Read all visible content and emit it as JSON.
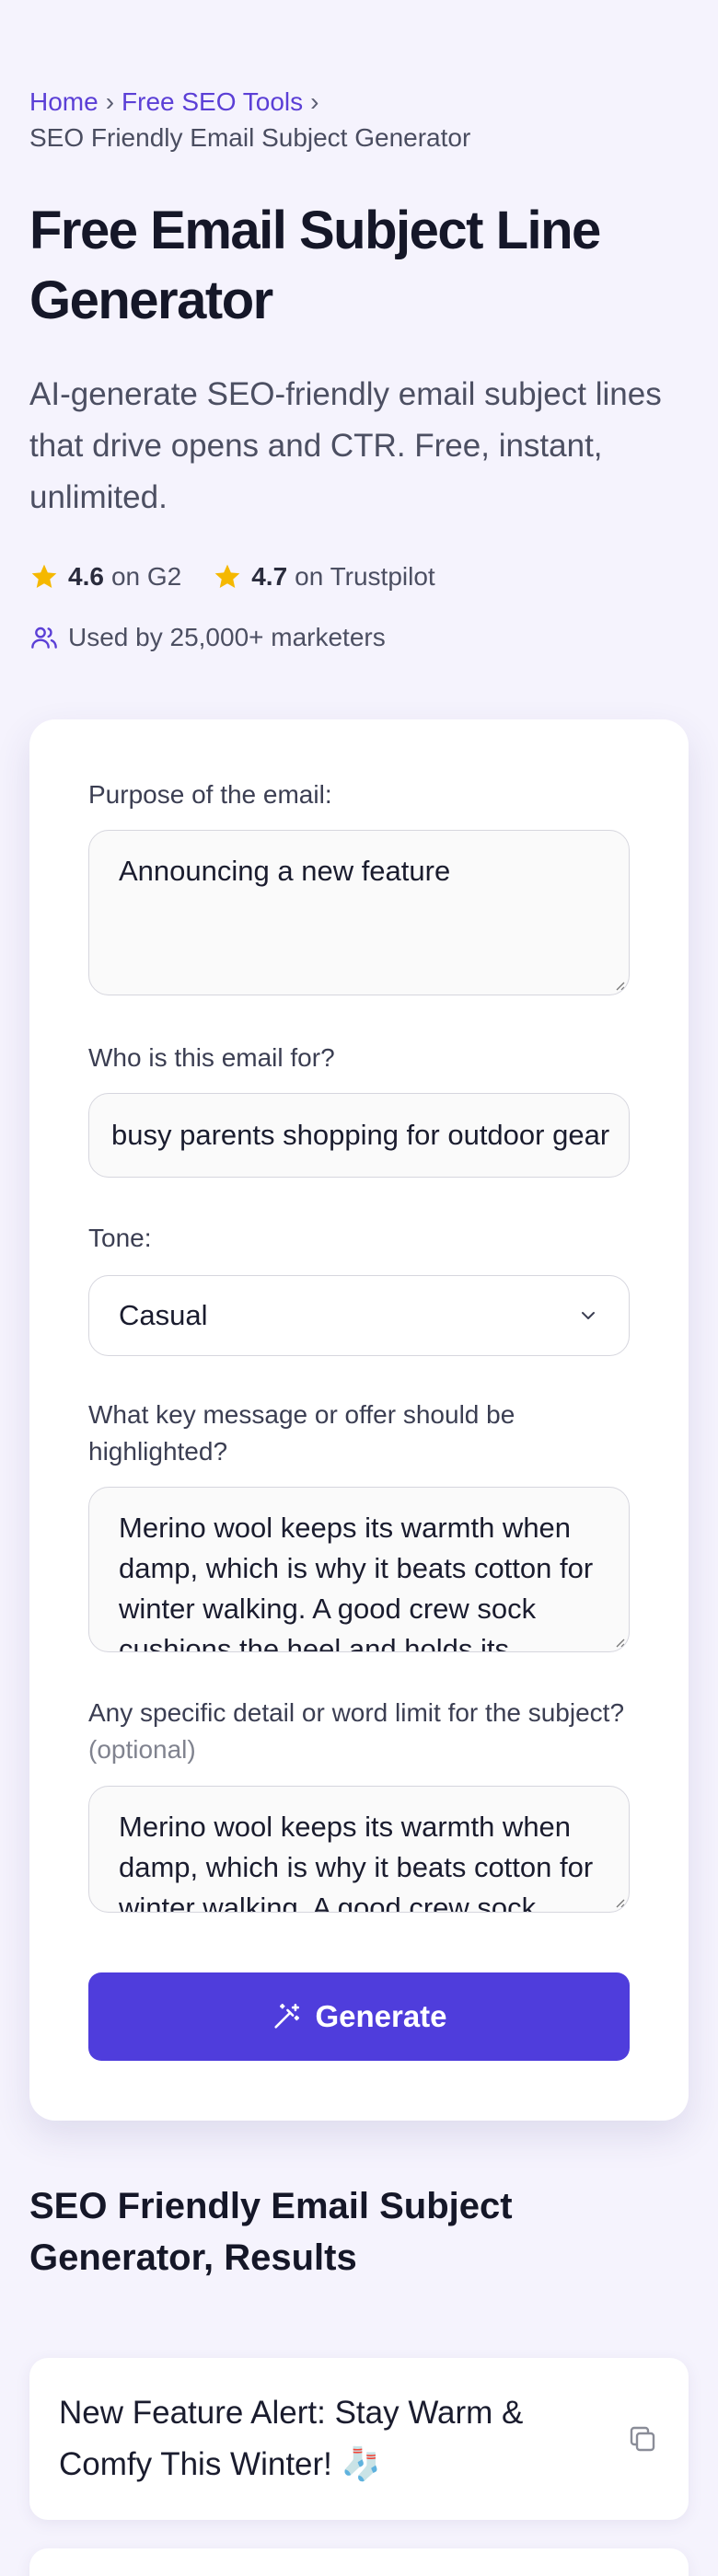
{
  "breadcrumb": {
    "home": "Home",
    "tools": "Free SEO Tools",
    "separator": "›",
    "current": "SEO Friendly Email Subject Generator"
  },
  "header": {
    "title": "Free Email Subject Line Generator",
    "subtitle": "AI-generate SEO-friendly email subject lines that drive opens and CTR. Free, instant, unlimited."
  },
  "ratings": [
    {
      "score": "4.6",
      "site": "on G2"
    },
    {
      "score": "4.7",
      "site": "on Trustpilot"
    }
  ],
  "users_text": "Used by 25,000+ marketers",
  "form": {
    "purpose_label": "Purpose of the email:",
    "purpose_value": "Announcing a new feature",
    "audience_label": "Who is this email for?",
    "audience_value": "busy parents shopping for outdoor gear",
    "tone_label": "Tone:",
    "tone_value": "Casual",
    "message_label": "What key message or offer should be highlighted?",
    "message_value": "Merino wool keeps its warmth when damp, which is why it beats cotton for winter walking. A good crew sock cushions the heel and holds its shape.",
    "detail_label": "Any specific detail or word limit for the subject?",
    "detail_optional": "(optional)",
    "detail_value": "Merino wool keeps its warmth when damp, which is why it beats cotton for winter walking. A good crew sock cushions the heel.",
    "generate_label": "Generate"
  },
  "results": {
    "title": "SEO Friendly Email Subject Generator, Results",
    "items": [
      {
        "text": "New Feature Alert: Stay Warm & Comfy This Winter! 🧦"
      }
    ]
  },
  "colors": {
    "accent": "#4f3ddc",
    "link": "#5b3fd6",
    "star": "#f5b800",
    "background": "#f5f3fd"
  },
  "icons": {
    "star": "star-icon",
    "users": "users-icon",
    "chevron": "chevron-down-icon",
    "wand": "magic-wand-icon",
    "copy": "copy-icon"
  }
}
